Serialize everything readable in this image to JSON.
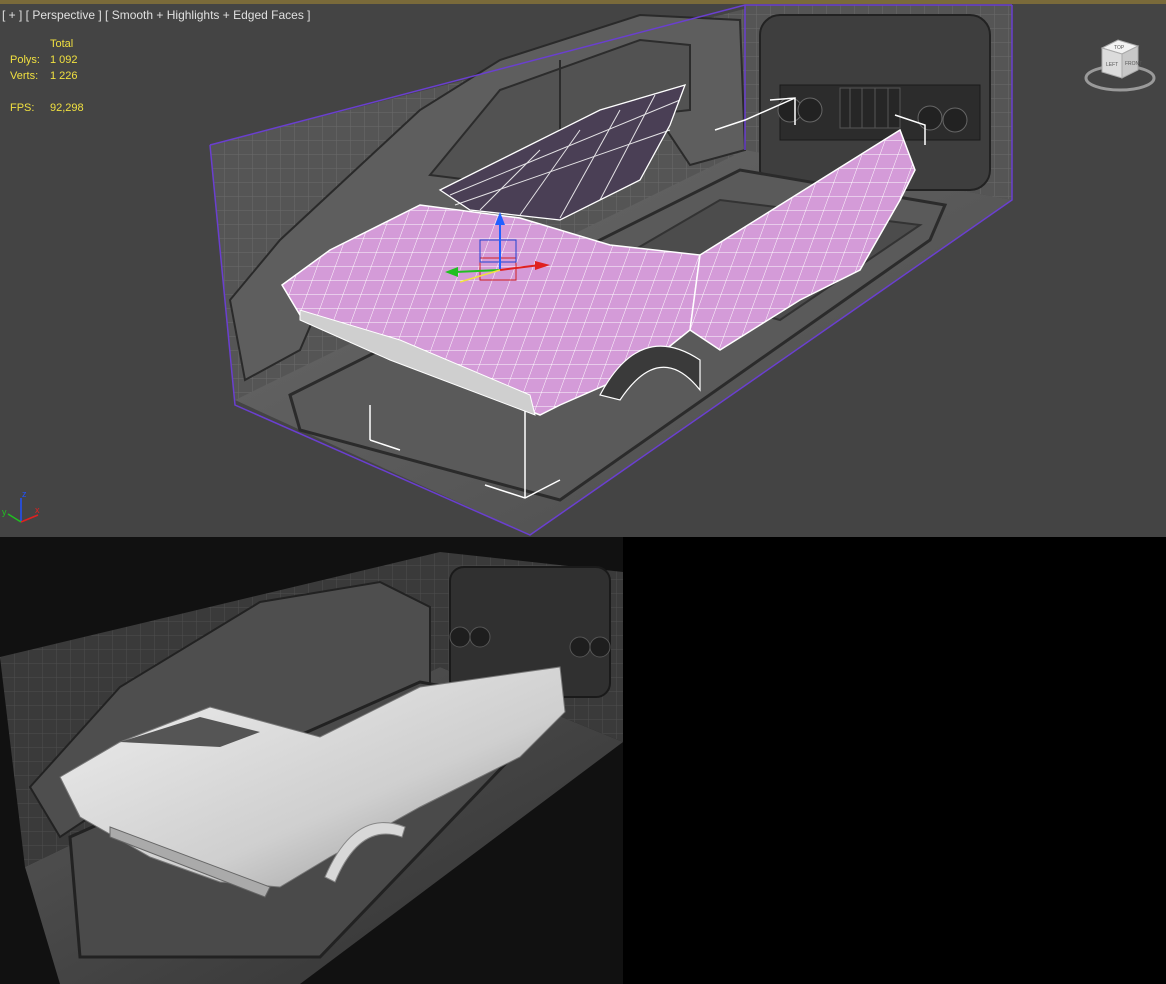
{
  "viewport": {
    "label": "[ + ] [ Perspective ] [ Smooth + Highlights + Edged Faces ]",
    "stats": {
      "header": "Total",
      "polys_label": "Polys:",
      "polys_value": "1 092",
      "verts_label": "Verts:",
      "verts_value": "1 226",
      "fps_label": "FPS:",
      "fps_value": "92,298"
    },
    "axis_labels": {
      "z": "z",
      "y": "y",
      "x": "x"
    },
    "viewcube_labels": {
      "top": "TOP",
      "left": "LEFT",
      "front": "FRONT"
    },
    "colors": {
      "background": "#444444",
      "stats_text": "#f0e040",
      "selection_box": "#6a3fd0",
      "mesh_fill": "#d8a0dc",
      "wire": "#ffffff"
    }
  },
  "render": {
    "colors": {
      "background": "#111111"
    }
  },
  "icons": [
    "viewcube-icon",
    "axis-tripod-icon",
    "transform-gizmo-icon"
  ]
}
